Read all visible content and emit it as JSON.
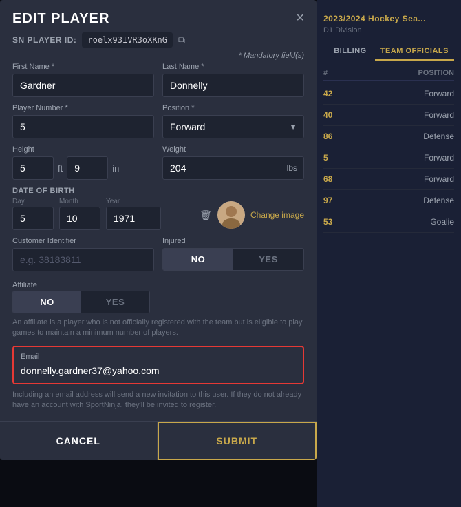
{
  "modal": {
    "title": "EDIT PLAYER",
    "close_label": "×",
    "sn_label": "SN PLAYER ID:",
    "sn_value": "roelx93IVR3oXKnG",
    "mandatory_text": "* Mandatory field(s)",
    "first_name_label": "First Name *",
    "first_name_value": "Gardner",
    "last_name_label": "Last Name *",
    "last_name_value": "Donnelly",
    "player_number_label": "Player Number *",
    "player_number_value": "5",
    "position_label": "Position *",
    "position_value": "Forward",
    "height_label": "Height",
    "height_ft": "5",
    "height_ft_unit": "ft",
    "height_in": "9",
    "height_in_unit": "in",
    "weight_label": "Weight",
    "weight_value": "204",
    "weight_unit": "lbs",
    "dob_label": "DATE OF BIRTH",
    "dob_day_label": "Day",
    "dob_day_value": "5",
    "dob_month_label": "Month",
    "dob_month_value": "10",
    "dob_year_label": "Year",
    "dob_year_value": "1971",
    "change_image_label": "Change image",
    "customer_id_label": "Customer Identifier",
    "customer_id_placeholder": "e.g. 38183811",
    "injured_label": "Injured",
    "injured_no": "NO",
    "injured_yes": "YES",
    "affiliate_label": "Affiliate",
    "affiliate_no": "NO",
    "affiliate_yes": "YES",
    "affiliate_note": "An affiliate is a player who is not officially registered with the team but is eligible to play games to maintain a minimum number of players.",
    "email_label": "Email",
    "email_value": "donnelly.gardner37@yahoo.com",
    "email_note": "Including an email address will send a new invitation to this user. If they do not already have an account with SportNinja, they'll be invited to register.",
    "cancel_label": "CANCEL",
    "submit_label": "SUBMIT"
  },
  "background": {
    "season_title": "2023/2024 Hockey Sea...",
    "division": "D1 Division",
    "tab_billing": "BILLING",
    "tab_team_officials": "TEAM OFFICIALS",
    "col_hash": "#",
    "col_position": "POSITION",
    "rows": [
      {
        "number": "42",
        "position": "Forward"
      },
      {
        "number": "40",
        "position": "Forward"
      },
      {
        "number": "86",
        "position": "Defense"
      },
      {
        "number": "5",
        "position": "Forward"
      },
      {
        "number": "68",
        "position": "Forward"
      },
      {
        "number": "97",
        "position": "Defense"
      },
      {
        "number": "53",
        "position": "Goalie"
      }
    ]
  }
}
